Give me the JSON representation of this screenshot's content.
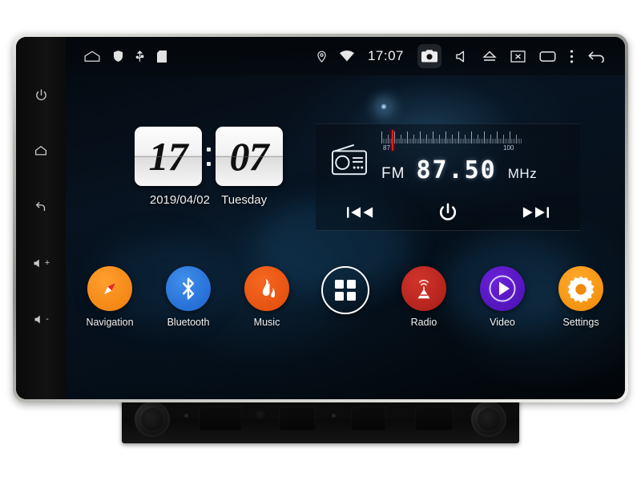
{
  "device": {
    "name": "android-car-head-unit",
    "bezel_color": "#b9b9b4",
    "screen_bg_color": "#05101b"
  },
  "hard_keys": [
    {
      "name": "power-key",
      "icon": "power-icon"
    },
    {
      "name": "home-key",
      "icon": "home-icon"
    },
    {
      "name": "back-key",
      "icon": "back-arrow-icon"
    },
    {
      "name": "volume-up-key",
      "icon": "volume-up-icon",
      "label": "+"
    },
    {
      "name": "volume-down-key",
      "icon": "volume-down-icon",
      "label": "-"
    }
  ],
  "status_bar": {
    "time": "17:07",
    "left_icons": [
      {
        "name": "home-icon",
        "label": "home"
      },
      {
        "name": "shield-icon",
        "label": "shield"
      },
      {
        "name": "usb-icon",
        "label": "usb"
      },
      {
        "name": "sd-card-icon",
        "label": "sd-card"
      }
    ],
    "right_icons": [
      {
        "name": "location-pin-icon",
        "label": "location"
      },
      {
        "name": "wifi-icon",
        "label": "wifi"
      },
      {
        "name": "camera-icon",
        "label": "camera",
        "pressed": true
      },
      {
        "name": "volume-mute-icon",
        "label": "mute"
      },
      {
        "name": "eject-icon",
        "label": "eject"
      },
      {
        "name": "screen-off-icon",
        "label": "screen-off"
      },
      {
        "name": "recents-icon",
        "label": "recents"
      },
      {
        "name": "overflow-menu-icon",
        "label": "more"
      },
      {
        "name": "back-arrow-icon",
        "label": "back"
      }
    ]
  },
  "clock_widget": {
    "hours": "17",
    "minutes": "07",
    "date": "2019/04/02",
    "weekday": "Tuesday"
  },
  "radio_widget": {
    "icon": "radio-icon",
    "band": "FM",
    "frequency": "87.50",
    "unit": "MHz",
    "scale_low": "87",
    "scale_high": "100",
    "needle_color": "#e01b1b",
    "controls": [
      {
        "name": "previous-station-button",
        "icon": "skip-previous-icon"
      },
      {
        "name": "radio-power-button",
        "icon": "power-icon"
      },
      {
        "name": "next-station-button",
        "icon": "skip-next-icon"
      }
    ]
  },
  "apps": [
    {
      "name": "app-navigation",
      "label": "Navigation",
      "icon": "compass-icon",
      "color": "#f07d0a"
    },
    {
      "name": "app-bluetooth",
      "label": "Bluetooth",
      "icon": "bluetooth-icon",
      "color": "#1d63cf"
    },
    {
      "name": "app-music",
      "label": "Music",
      "icon": "music-note-icon",
      "color": "#e04b0c"
    },
    {
      "name": "app-drawer",
      "label": "",
      "icon": "apps-grid-icon",
      "color": "#ffffff"
    },
    {
      "name": "app-radio",
      "label": "Radio",
      "icon": "radio-tower-icon",
      "color": "#a81d16"
    },
    {
      "name": "app-video",
      "label": "Video",
      "icon": "play-circle-icon",
      "color": "#4a0fb0"
    },
    {
      "name": "app-settings",
      "label": "Settings",
      "icon": "gear-icon",
      "color": "#f08a06"
    }
  ]
}
